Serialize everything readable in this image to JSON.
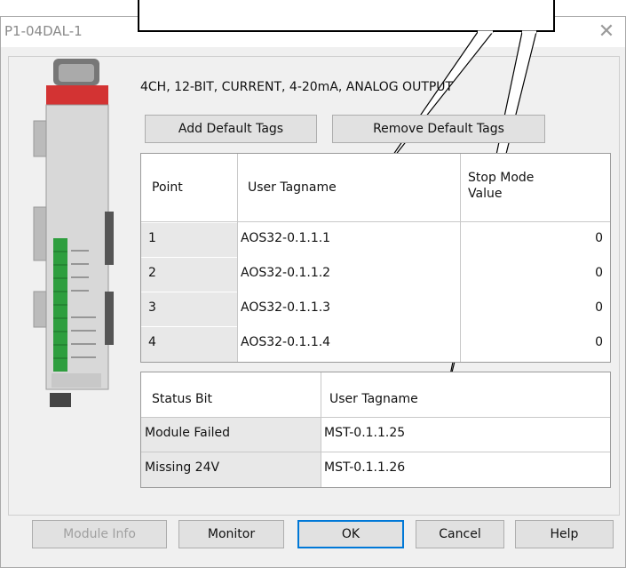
{
  "window": {
    "title": "P1-04DAL-1",
    "close_glyph": "✕"
  },
  "module": {
    "description": "4CH, 12-BIT, CURRENT, 4-20mA, ANALOG OUTPUT"
  },
  "top_buttons": {
    "add_default": "Add Default Tags",
    "remove_default": "Remove Default Tags"
  },
  "output_table": {
    "headers": [
      "Point",
      "User Tagname",
      "Stop Mode Value"
    ],
    "rows": [
      {
        "point": "1",
        "tag": "AOS32-0.1.1.1",
        "stop": "0"
      },
      {
        "point": "2",
        "tag": "AOS32-0.1.1.2",
        "stop": "0"
      },
      {
        "point": "3",
        "tag": "AOS32-0.1.1.3",
        "stop": "0"
      },
      {
        "point": "4",
        "tag": "AOS32-0.1.1.4",
        "stop": "0"
      }
    ]
  },
  "status_table": {
    "headers": [
      "Status Bit",
      "User Tagname"
    ],
    "rows": [
      {
        "bit": "Module Failed",
        "tag": "MST-0.1.1.25"
      },
      {
        "bit": "Missing 24V",
        "tag": "MST-0.1.1.26"
      }
    ]
  },
  "bottom_buttons": {
    "module_info": "Module Info",
    "monitor": "Monitor",
    "ok": "OK",
    "cancel": "Cancel",
    "help": "Help"
  },
  "colors": {
    "accent": "#0078d7",
    "module_red": "#d33333",
    "terminal_green": "#2e9e3e"
  }
}
